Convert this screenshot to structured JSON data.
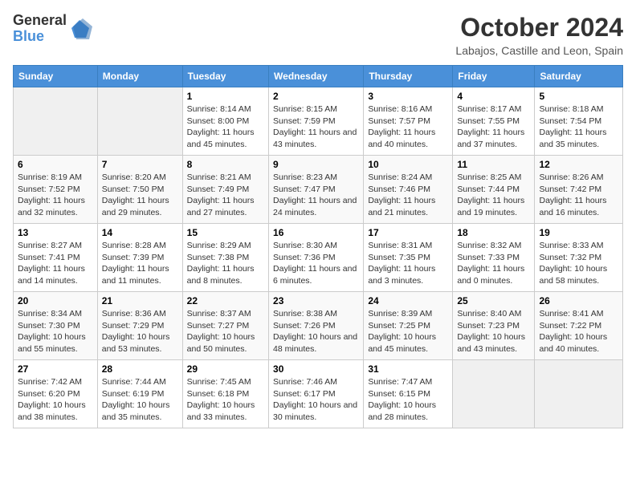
{
  "header": {
    "logo_line1": "General",
    "logo_line2": "Blue",
    "month_title": "October 2024",
    "location": "Labajos, Castille and Leon, Spain"
  },
  "days_of_week": [
    "Sunday",
    "Monday",
    "Tuesday",
    "Wednesday",
    "Thursday",
    "Friday",
    "Saturday"
  ],
  "weeks": [
    [
      {
        "day": "",
        "info": ""
      },
      {
        "day": "",
        "info": ""
      },
      {
        "day": "1",
        "info": "Sunrise: 8:14 AM\nSunset: 8:00 PM\nDaylight: 11 hours and 45 minutes."
      },
      {
        "day": "2",
        "info": "Sunrise: 8:15 AM\nSunset: 7:59 PM\nDaylight: 11 hours and 43 minutes."
      },
      {
        "day": "3",
        "info": "Sunrise: 8:16 AM\nSunset: 7:57 PM\nDaylight: 11 hours and 40 minutes."
      },
      {
        "day": "4",
        "info": "Sunrise: 8:17 AM\nSunset: 7:55 PM\nDaylight: 11 hours and 37 minutes."
      },
      {
        "day": "5",
        "info": "Sunrise: 8:18 AM\nSunset: 7:54 PM\nDaylight: 11 hours and 35 minutes."
      }
    ],
    [
      {
        "day": "6",
        "info": "Sunrise: 8:19 AM\nSunset: 7:52 PM\nDaylight: 11 hours and 32 minutes."
      },
      {
        "day": "7",
        "info": "Sunrise: 8:20 AM\nSunset: 7:50 PM\nDaylight: 11 hours and 29 minutes."
      },
      {
        "day": "8",
        "info": "Sunrise: 8:21 AM\nSunset: 7:49 PM\nDaylight: 11 hours and 27 minutes."
      },
      {
        "day": "9",
        "info": "Sunrise: 8:23 AM\nSunset: 7:47 PM\nDaylight: 11 hours and 24 minutes."
      },
      {
        "day": "10",
        "info": "Sunrise: 8:24 AM\nSunset: 7:46 PM\nDaylight: 11 hours and 21 minutes."
      },
      {
        "day": "11",
        "info": "Sunrise: 8:25 AM\nSunset: 7:44 PM\nDaylight: 11 hours and 19 minutes."
      },
      {
        "day": "12",
        "info": "Sunrise: 8:26 AM\nSunset: 7:42 PM\nDaylight: 11 hours and 16 minutes."
      }
    ],
    [
      {
        "day": "13",
        "info": "Sunrise: 8:27 AM\nSunset: 7:41 PM\nDaylight: 11 hours and 14 minutes."
      },
      {
        "day": "14",
        "info": "Sunrise: 8:28 AM\nSunset: 7:39 PM\nDaylight: 11 hours and 11 minutes."
      },
      {
        "day": "15",
        "info": "Sunrise: 8:29 AM\nSunset: 7:38 PM\nDaylight: 11 hours and 8 minutes."
      },
      {
        "day": "16",
        "info": "Sunrise: 8:30 AM\nSunset: 7:36 PM\nDaylight: 11 hours and 6 minutes."
      },
      {
        "day": "17",
        "info": "Sunrise: 8:31 AM\nSunset: 7:35 PM\nDaylight: 11 hours and 3 minutes."
      },
      {
        "day": "18",
        "info": "Sunrise: 8:32 AM\nSunset: 7:33 PM\nDaylight: 11 hours and 0 minutes."
      },
      {
        "day": "19",
        "info": "Sunrise: 8:33 AM\nSunset: 7:32 PM\nDaylight: 10 hours and 58 minutes."
      }
    ],
    [
      {
        "day": "20",
        "info": "Sunrise: 8:34 AM\nSunset: 7:30 PM\nDaylight: 10 hours and 55 minutes."
      },
      {
        "day": "21",
        "info": "Sunrise: 8:36 AM\nSunset: 7:29 PM\nDaylight: 10 hours and 53 minutes."
      },
      {
        "day": "22",
        "info": "Sunrise: 8:37 AM\nSunset: 7:27 PM\nDaylight: 10 hours and 50 minutes."
      },
      {
        "day": "23",
        "info": "Sunrise: 8:38 AM\nSunset: 7:26 PM\nDaylight: 10 hours and 48 minutes."
      },
      {
        "day": "24",
        "info": "Sunrise: 8:39 AM\nSunset: 7:25 PM\nDaylight: 10 hours and 45 minutes."
      },
      {
        "day": "25",
        "info": "Sunrise: 8:40 AM\nSunset: 7:23 PM\nDaylight: 10 hours and 43 minutes."
      },
      {
        "day": "26",
        "info": "Sunrise: 8:41 AM\nSunset: 7:22 PM\nDaylight: 10 hours and 40 minutes."
      }
    ],
    [
      {
        "day": "27",
        "info": "Sunrise: 7:42 AM\nSunset: 6:20 PM\nDaylight: 10 hours and 38 minutes."
      },
      {
        "day": "28",
        "info": "Sunrise: 7:44 AM\nSunset: 6:19 PM\nDaylight: 10 hours and 35 minutes."
      },
      {
        "day": "29",
        "info": "Sunrise: 7:45 AM\nSunset: 6:18 PM\nDaylight: 10 hours and 33 minutes."
      },
      {
        "day": "30",
        "info": "Sunrise: 7:46 AM\nSunset: 6:17 PM\nDaylight: 10 hours and 30 minutes."
      },
      {
        "day": "31",
        "info": "Sunrise: 7:47 AM\nSunset: 6:15 PM\nDaylight: 10 hours and 28 minutes."
      },
      {
        "day": "",
        "info": ""
      },
      {
        "day": "",
        "info": ""
      }
    ]
  ]
}
